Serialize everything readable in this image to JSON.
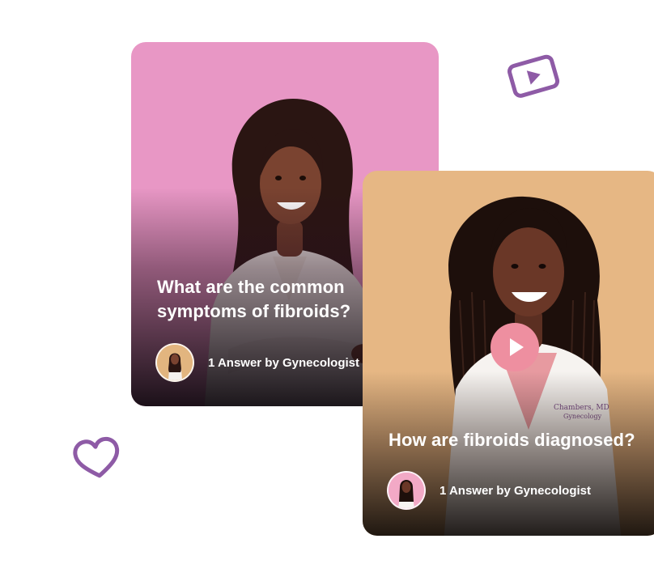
{
  "cards": [
    {
      "question": "What are the common symptoms of fibroids?",
      "answer_label": "1 Answer by Gynecologist",
      "background": "#e897c5"
    },
    {
      "question": "How are fibroids diagnosed?",
      "answer_label": "1 Answer by Gynecologist",
      "background": "#e6b784",
      "badge_text": "Chambers, MD",
      "badge_subtext": "Gynecology"
    }
  ],
  "colors": {
    "decoration": "#8e5ba6",
    "play_button": "#ee8fa0"
  },
  "icons": {
    "top_right": "video-play-icon",
    "bottom_left": "heart-icon",
    "card_center": "play-icon"
  }
}
